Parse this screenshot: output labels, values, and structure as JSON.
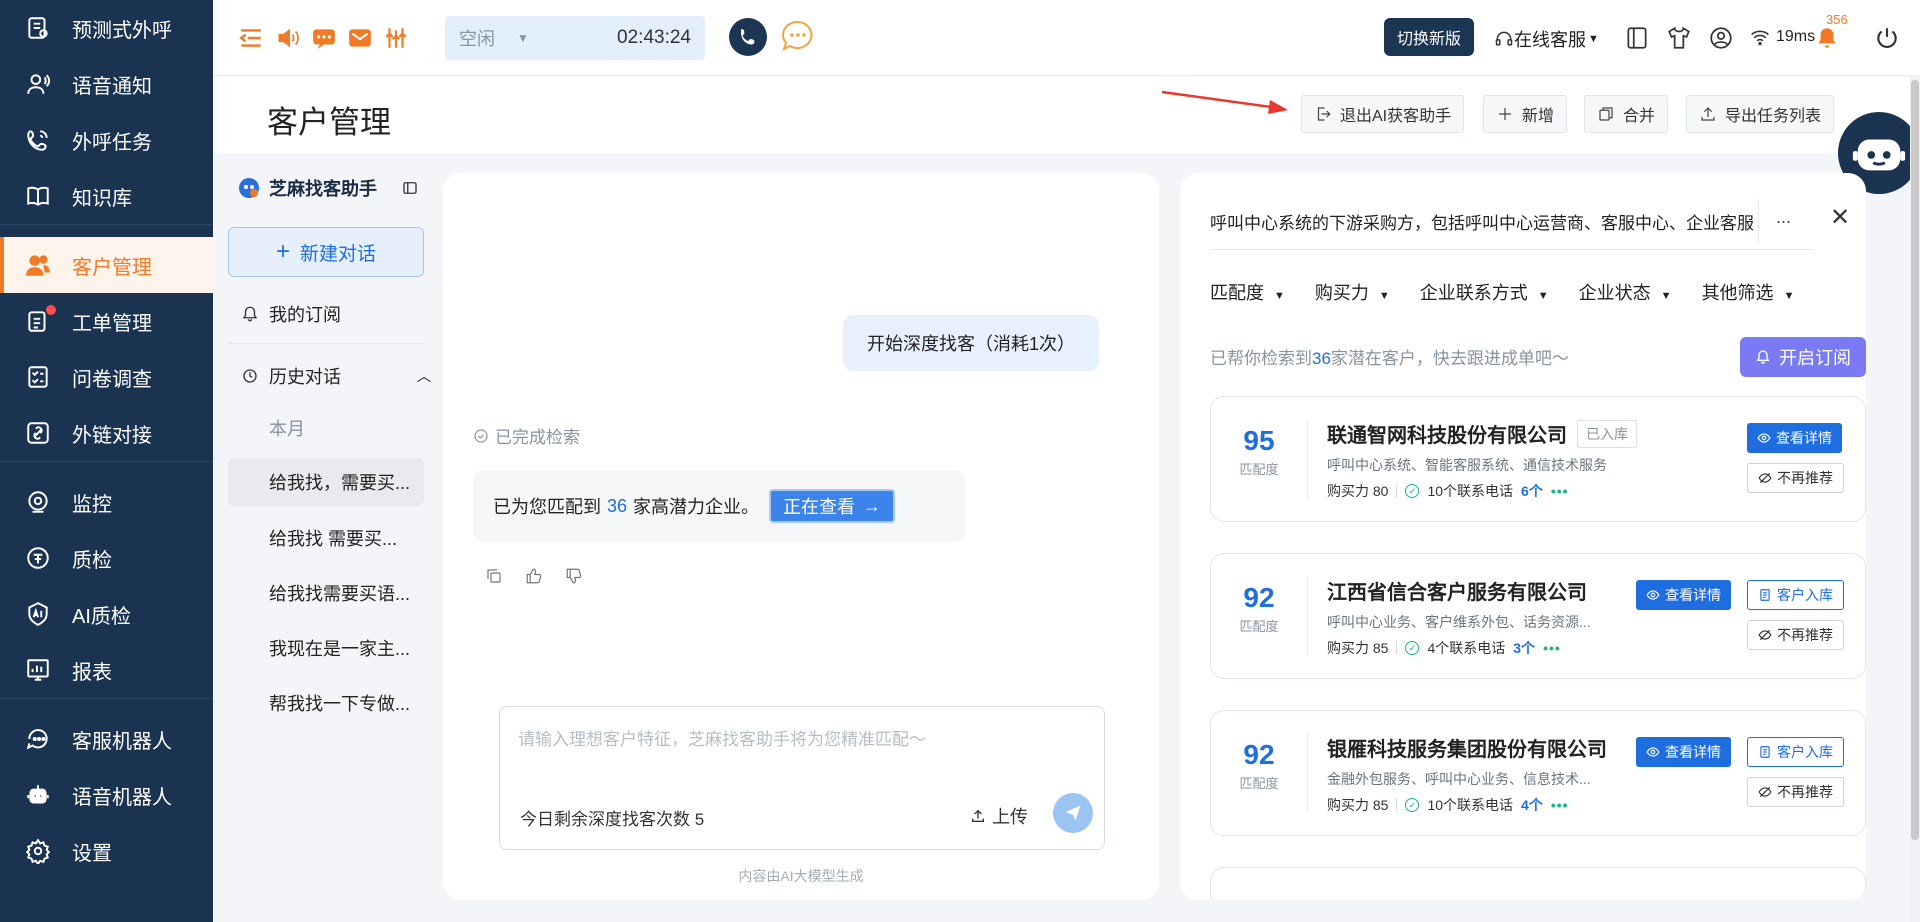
{
  "sidebar": {
    "groups": [
      [
        {
          "label": "预测式外呼",
          "icon": "predictive-dial-icon"
        },
        {
          "label": "语音通知",
          "icon": "voice-notice-icon"
        },
        {
          "label": "外呼任务",
          "icon": "outbound-task-icon"
        },
        {
          "label": "知识库",
          "icon": "book-icon"
        }
      ],
      [
        {
          "label": "客户管理",
          "icon": "customer-icon",
          "active": true
        },
        {
          "label": "工单管理",
          "icon": "ticket-icon",
          "dot": true
        },
        {
          "label": "问卷调查",
          "icon": "survey-icon"
        },
        {
          "label": "外链对接",
          "icon": "link-icon"
        }
      ],
      [
        {
          "label": "监控",
          "icon": "monitor-icon"
        },
        {
          "label": "质检",
          "icon": "quality-icon"
        },
        {
          "label": "AI质检",
          "icon": "ai-quality-icon"
        },
        {
          "label": "报表",
          "icon": "report-icon"
        }
      ],
      [
        {
          "label": "客服机器人",
          "icon": "chatbot-icon"
        },
        {
          "label": "语音机器人",
          "icon": "voice-robot-icon"
        },
        {
          "label": "设置",
          "icon": "settings-icon"
        }
      ]
    ]
  },
  "topbar": {
    "status": "空闲",
    "timer": "02:43:24",
    "new_version": "切换新版",
    "online_service": "在线客服",
    "latency": "19ms",
    "notification_count": "356"
  },
  "header": {
    "title": "客户管理",
    "buttons": [
      "退出AI获客助手",
      "新增",
      "合并",
      "导出任务列表"
    ]
  },
  "history": {
    "assistant_name": "芝麻找客助手",
    "new_chat": "新建对话",
    "subscription": "我的订阅",
    "history_label": "历史对话",
    "month": "本月",
    "items": [
      "给我找，需要买...",
      "给我找 需要买...",
      "给我找需要买语...",
      "我现在是一家主...",
      "帮我找一下专做..."
    ]
  },
  "chat": {
    "user_message": "开始深度找客（消耗1次）",
    "done_label": "已完成检索",
    "answer_prefix": "已为您匹配到",
    "answer_count": "36",
    "answer_suffix": "家高潜力企业。",
    "viewing_button": "正在查看",
    "placeholder": "请输入理想客户特征，芝麻找客助手将为您精准匹配～",
    "remaining": "今日剩余深度找客次数 5",
    "upload": "上传",
    "footnote": "内容由AI大模型生成"
  },
  "results": {
    "query": "呼叫中心系统的下游采购方，包括呼叫中心运营商、客服中心、企业客服部门",
    "more": "...",
    "filters": [
      "匹配度",
      "购买力",
      "企业联系方式",
      "企业状态",
      "其他筛选"
    ],
    "found_prefix": "已帮你检索到",
    "found_count": "36",
    "found_suffix": "家潜在客户，快去跟进成单吧～",
    "subscribe": "开启订阅",
    "score_label": "匹配度",
    "view_detail": "查看详情",
    "add_to_db": "客户入库",
    "not_recommend": "不再推荐",
    "in_db_tag": "已入库",
    "cards": [
      {
        "score": "95",
        "name": "联通智网科技股份有限公司",
        "in_db": true,
        "desc": "呼叫中心系统、智能客服系统、通信技术服务",
        "power": "购买力 80",
        "phones": "10个联系电话",
        "contacts": "6个"
      },
      {
        "score": "92",
        "name": "江西省信合客户服务有限公司",
        "in_db": false,
        "desc": "呼叫中心业务、客户维系外包、话务资源...",
        "power": "购买力 85",
        "phones": "4个联系电话",
        "contacts": "3个"
      },
      {
        "score": "92",
        "name": "银雁科技服务集团股份有限公司",
        "in_db": false,
        "desc": "金融外包服务、呼叫中心业务、信息技术...",
        "power": "购买力 85",
        "phones": "10个联系电话",
        "contacts": "4个"
      }
    ]
  },
  "colors": {
    "accent": "#f07a26",
    "primary": "#1f6ee0",
    "sidebar": "#1a3350"
  }
}
